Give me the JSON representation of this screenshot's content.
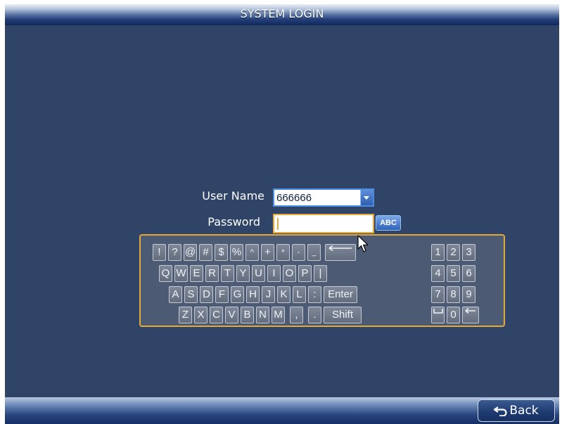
{
  "title": "SYSTEM LOGIN",
  "login": {
    "user_label": "User Name",
    "user_value": "666666",
    "password_label": "Password",
    "password_value": "",
    "input_mode": "ABC"
  },
  "keyboard": {
    "rows": [
      [
        "!",
        "?",
        "@",
        "#",
        "$",
        "%",
        "^",
        "+",
        "*",
        "-",
        "_"
      ],
      [
        "Q",
        "W",
        "E",
        "R",
        "T",
        "Y",
        "U",
        "I",
        "O",
        "P",
        "|"
      ],
      [
        "A",
        "S",
        "D",
        "F",
        "G",
        "H",
        "J",
        "K",
        "L",
        ":",
        "Enter"
      ],
      [
        "Z",
        "X",
        "C",
        "V",
        "B",
        "N",
        "M",
        ",",
        ".",
        "Shift"
      ]
    ],
    "numpad": [
      [
        "1",
        "2",
        "3"
      ],
      [
        "4",
        "5",
        "6"
      ],
      [
        "7",
        "8",
        "9"
      ],
      [
        "",
        "0",
        ""
      ]
    ]
  },
  "footer": {
    "back_label": "Back"
  },
  "colors": {
    "background": "#304468",
    "focus_border": "#e3a93a",
    "select_border": "#4b8de0"
  }
}
